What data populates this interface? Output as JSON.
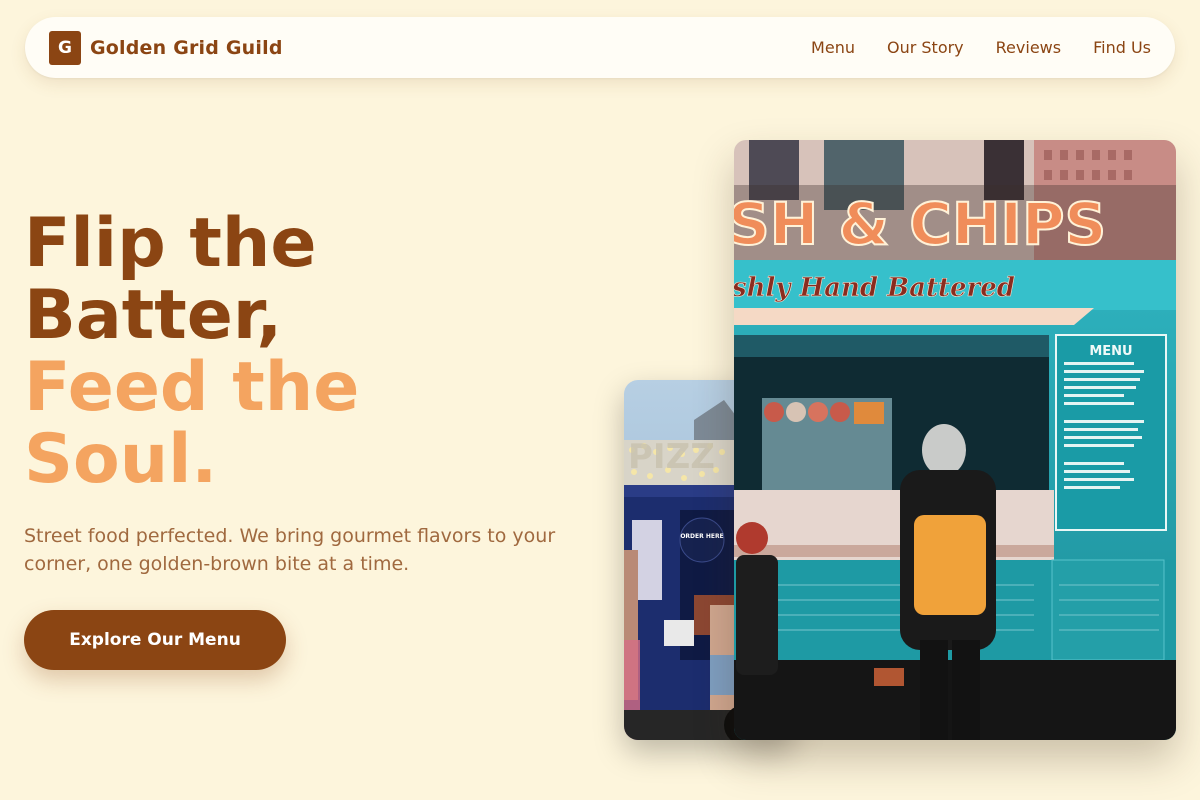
{
  "brand": {
    "badge": "G",
    "name": "Golden Grid Guild"
  },
  "nav": {
    "links": [
      {
        "label": "Menu"
      },
      {
        "label": "Our Story"
      },
      {
        "label": "Reviews"
      },
      {
        "label": "Find Us"
      }
    ]
  },
  "hero": {
    "title_line1": "Flip the",
    "title_line2": "Batter,",
    "title_line3": "Feed the",
    "title_line4": "Soul.",
    "subtitle": "Street food perfected. We bring gourmet flavors to your corner, one golden-brown bite at a time.",
    "cta_label": "Explore Our Menu"
  },
  "images": {
    "front_sign": "SH & CHIPS",
    "front_script": "shly Hand Battered",
    "front_menu_title": "MENU",
    "back_sign": "PIZZ",
    "back_order_here": "ORDER HERE"
  },
  "colors": {
    "background": "#fdf5dc",
    "primary": "#8b4513",
    "accent": "#f4a460",
    "subtitle": "#a0693f"
  }
}
